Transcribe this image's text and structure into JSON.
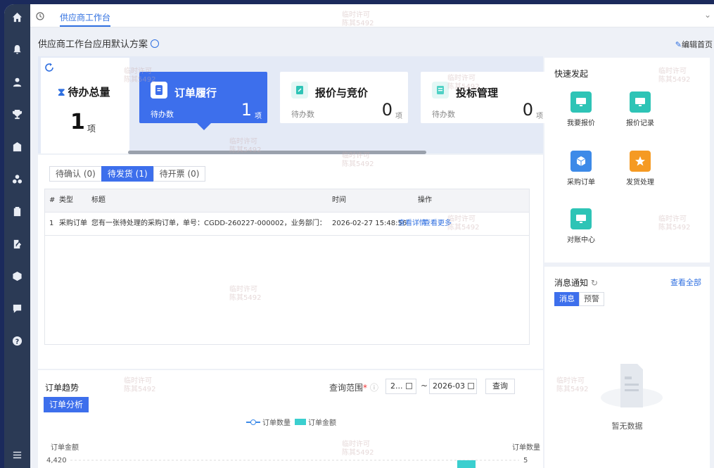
{
  "tabbar": {
    "active_tab": "供应商工作台"
  },
  "page": {
    "title": "供应商工作台应用默认方案",
    "edit_home": "编辑首页"
  },
  "todo": {
    "total_label": "待办总量",
    "total_count": "1",
    "total_unit": "项",
    "cards": [
      {
        "title": "订单履行",
        "label": "待办数",
        "count": "1",
        "unit": "项",
        "active": true,
        "color": "#3d6fec"
      },
      {
        "title": "报价与竞价",
        "label": "待办数",
        "count": "0",
        "unit": "项",
        "active": false,
        "color": "#2ec4b6"
      },
      {
        "title": "投标管理",
        "label": "待办数",
        "count": "0",
        "unit": "项",
        "active": false,
        "color": "#4fd1c5"
      }
    ]
  },
  "list": {
    "tabs": [
      "待确认 (0)",
      "待发货 (1)",
      "待开票 (0)"
    ],
    "active_tab": 1,
    "columns": [
      "#",
      "类型",
      "标题",
      "时间",
      "操作"
    ],
    "rows": [
      {
        "index": "1",
        "type": "采购订单",
        "title": "您有一张待处理的采购订单，单号：CGDD-260227-000002，业务部门：中国装备集团...",
        "time": "2026-02-27 15:48:56",
        "action_detail": "查看详情",
        "action_more": "查看更多"
      }
    ]
  },
  "trend": {
    "title": "订单趋势",
    "analysis_button": "订单分析",
    "range_label": "查询范围",
    "range_required": "*",
    "date_start": "2...",
    "date_sep": "~",
    "date_end": "2026-03",
    "query_button": "查询",
    "legend_count": "订单数量",
    "legend_amount": "订单金额",
    "axis_left_label": "订单金额",
    "axis_right_label": "订单数量"
  },
  "chart_data": {
    "type": "bar",
    "title": "",
    "ylabel": "订单金额",
    "y2label": "订单数量",
    "y_tick_top": "4,420",
    "y2_tick_top": "5",
    "series": [
      {
        "name": "订单金额",
        "values": [
          4420
        ],
        "data_labels": [
          "4420"
        ]
      },
      {
        "name": "订单数量",
        "values": []
      }
    ]
  },
  "quick": {
    "title": "快速发起",
    "items": [
      {
        "label": "我要报价",
        "icon": "monitor-icon",
        "color": "#2ec4b6"
      },
      {
        "label": "报价记录",
        "icon": "monitor-icon",
        "color": "#2ec4b6"
      },
      {
        "label": "采购订单",
        "icon": "box-icon",
        "color": "#3d8ae8"
      },
      {
        "label": "发货处理",
        "icon": "star-icon",
        "color": "#f59a23"
      },
      {
        "label": "对账中心",
        "icon": "monitor-icon",
        "color": "#2ec4b6"
      }
    ]
  },
  "messages": {
    "title": "消息通知",
    "view_all": "查看全部",
    "tabs": [
      "消息",
      "预警"
    ],
    "empty_text": "暂无数据"
  },
  "watermark": [
    "临时许可",
    "陈其5492"
  ]
}
